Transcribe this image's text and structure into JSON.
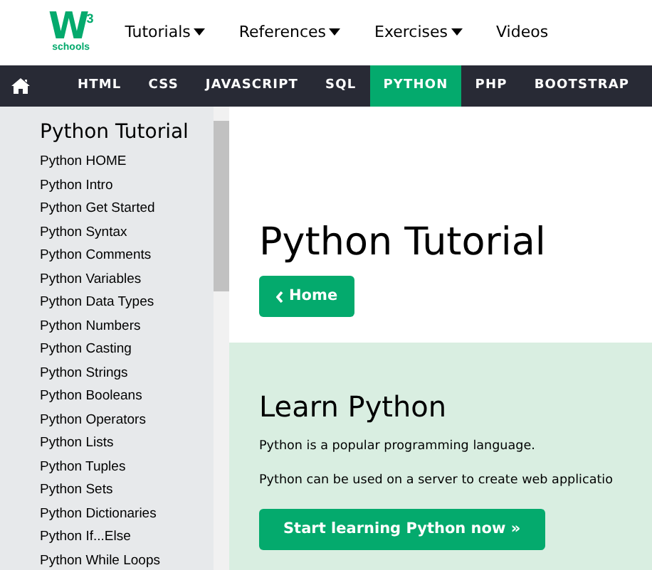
{
  "logo": {
    "mark": "W",
    "superscript": "3",
    "caption": "schools"
  },
  "top_menu": [
    {
      "label": "Tutorials",
      "dropdown": true
    },
    {
      "label": "References",
      "dropdown": true
    },
    {
      "label": "Exercises",
      "dropdown": true
    },
    {
      "label": "Videos",
      "dropdown": false
    }
  ],
  "topics": [
    {
      "label": "HTML",
      "selected": false
    },
    {
      "label": "CSS",
      "selected": false
    },
    {
      "label": "JAVASCRIPT",
      "selected": false
    },
    {
      "label": "SQL",
      "selected": false
    },
    {
      "label": "PYTHON",
      "selected": true
    },
    {
      "label": "PHP",
      "selected": false
    },
    {
      "label": "BOOTSTRAP",
      "selected": false
    }
  ],
  "sidebar": {
    "title": "Python Tutorial",
    "items": [
      "Python HOME",
      "Python Intro",
      "Python Get Started",
      "Python Syntax",
      "Python Comments",
      "Python Variables",
      "Python Data Types",
      "Python Numbers",
      "Python Casting",
      "Python Strings",
      "Python Booleans",
      "Python Operators",
      "Python Lists",
      "Python Tuples",
      "Python Sets",
      "Python Dictionaries",
      "Python If...Else",
      "Python While Loops"
    ]
  },
  "main": {
    "title": "Python Tutorial",
    "home_button": "Home",
    "intro": {
      "heading": "Learn Python",
      "paragraphs": [
        "Python is a popular programming language.",
        "Python can be used on a server to create web applicatio"
      ],
      "button": "Start learning Python now »"
    }
  }
}
